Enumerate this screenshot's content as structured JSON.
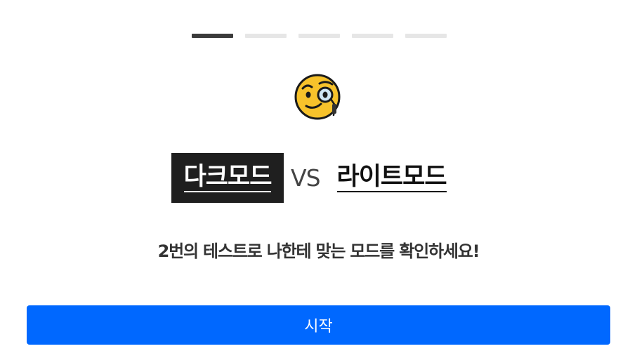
{
  "progress": {
    "total_steps": 5,
    "current_step": 1
  },
  "hero": {
    "emoji_icon": "face-with-monocle-icon"
  },
  "title": {
    "dark_label": "다크모드",
    "vs_label": "VS",
    "light_label": "라이트모드"
  },
  "subtitle": "2번의 테스트로 나한테 맞는 모드를 확인하세요!",
  "start_button": {
    "label": "시작"
  },
  "colors": {
    "accent": "#0068ff",
    "dark_chip": "#1f1f1f",
    "progress_active": "#3b3b3b",
    "progress_inactive": "#e6e6e6"
  }
}
